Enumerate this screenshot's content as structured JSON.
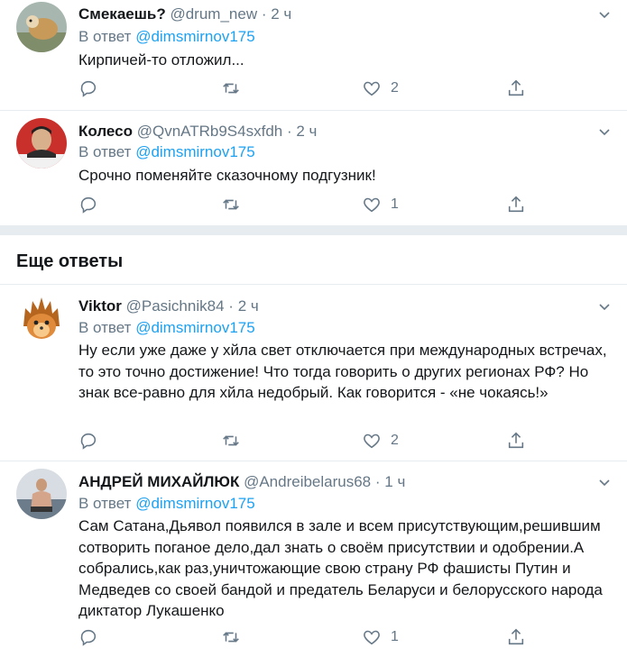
{
  "tweets": [
    {
      "name": "Смекаешь?",
      "handle": "@drum_new",
      "time": "2 ч",
      "reply_prefix": "В ответ",
      "reply_mention": "@dimsmirnov175",
      "text": "Кирпичей-то отложил...",
      "likes": "2",
      "avatar": "dog-avatar"
    },
    {
      "name": "Колесо",
      "handle": "@QvnATRb9S4sxfdh",
      "time": "2 ч",
      "reply_prefix": "В ответ",
      "reply_mention": "@dimsmirnov175",
      "text": "Срочно поменяйте сказочному подгузник!",
      "likes": "1",
      "avatar": "man-portrait-avatar"
    },
    {
      "name": "Viktor",
      "handle": "@Pasichnik84",
      "time": "2 ч",
      "reply_prefix": "В ответ",
      "reply_mention": "@dimsmirnov175",
      "text": "Ну если уже даже у хйла свет отключается при международных встречах, то это точно достижение! Что тогда говорить о других регионах РФ? Но знак все-равно для хйла недобрый. Как говорится - «не чокаясь!»",
      "likes": "2",
      "avatar": "hedgehog-avatar"
    },
    {
      "name": "АНДРЕЙ МИХАЙЛЮК",
      "handle": "@Andreibelarus68",
      "time": "1 ч",
      "reply_prefix": "В ответ",
      "reply_mention": "@dimsmirnov175",
      "text": "Сам Сатана,Дьявол появился в зале и всем присутствующим,решившим сотворить поганое дело,дал знать о своём присутствии и одобрении.А собрались,как раз,уничтожающие свою страну РФ фашисты Путин и Медведев со своей бандой и предатель Беларуси и белорусского народа диктатор Лукашенко",
      "likes": "1",
      "avatar": "man-swimming-avatar"
    }
  ],
  "more_replies_title": "Еще ответы",
  "colors": {
    "accent": "#1da1f2",
    "secondary_text": "#657786",
    "divider": "#e6ecf0"
  }
}
